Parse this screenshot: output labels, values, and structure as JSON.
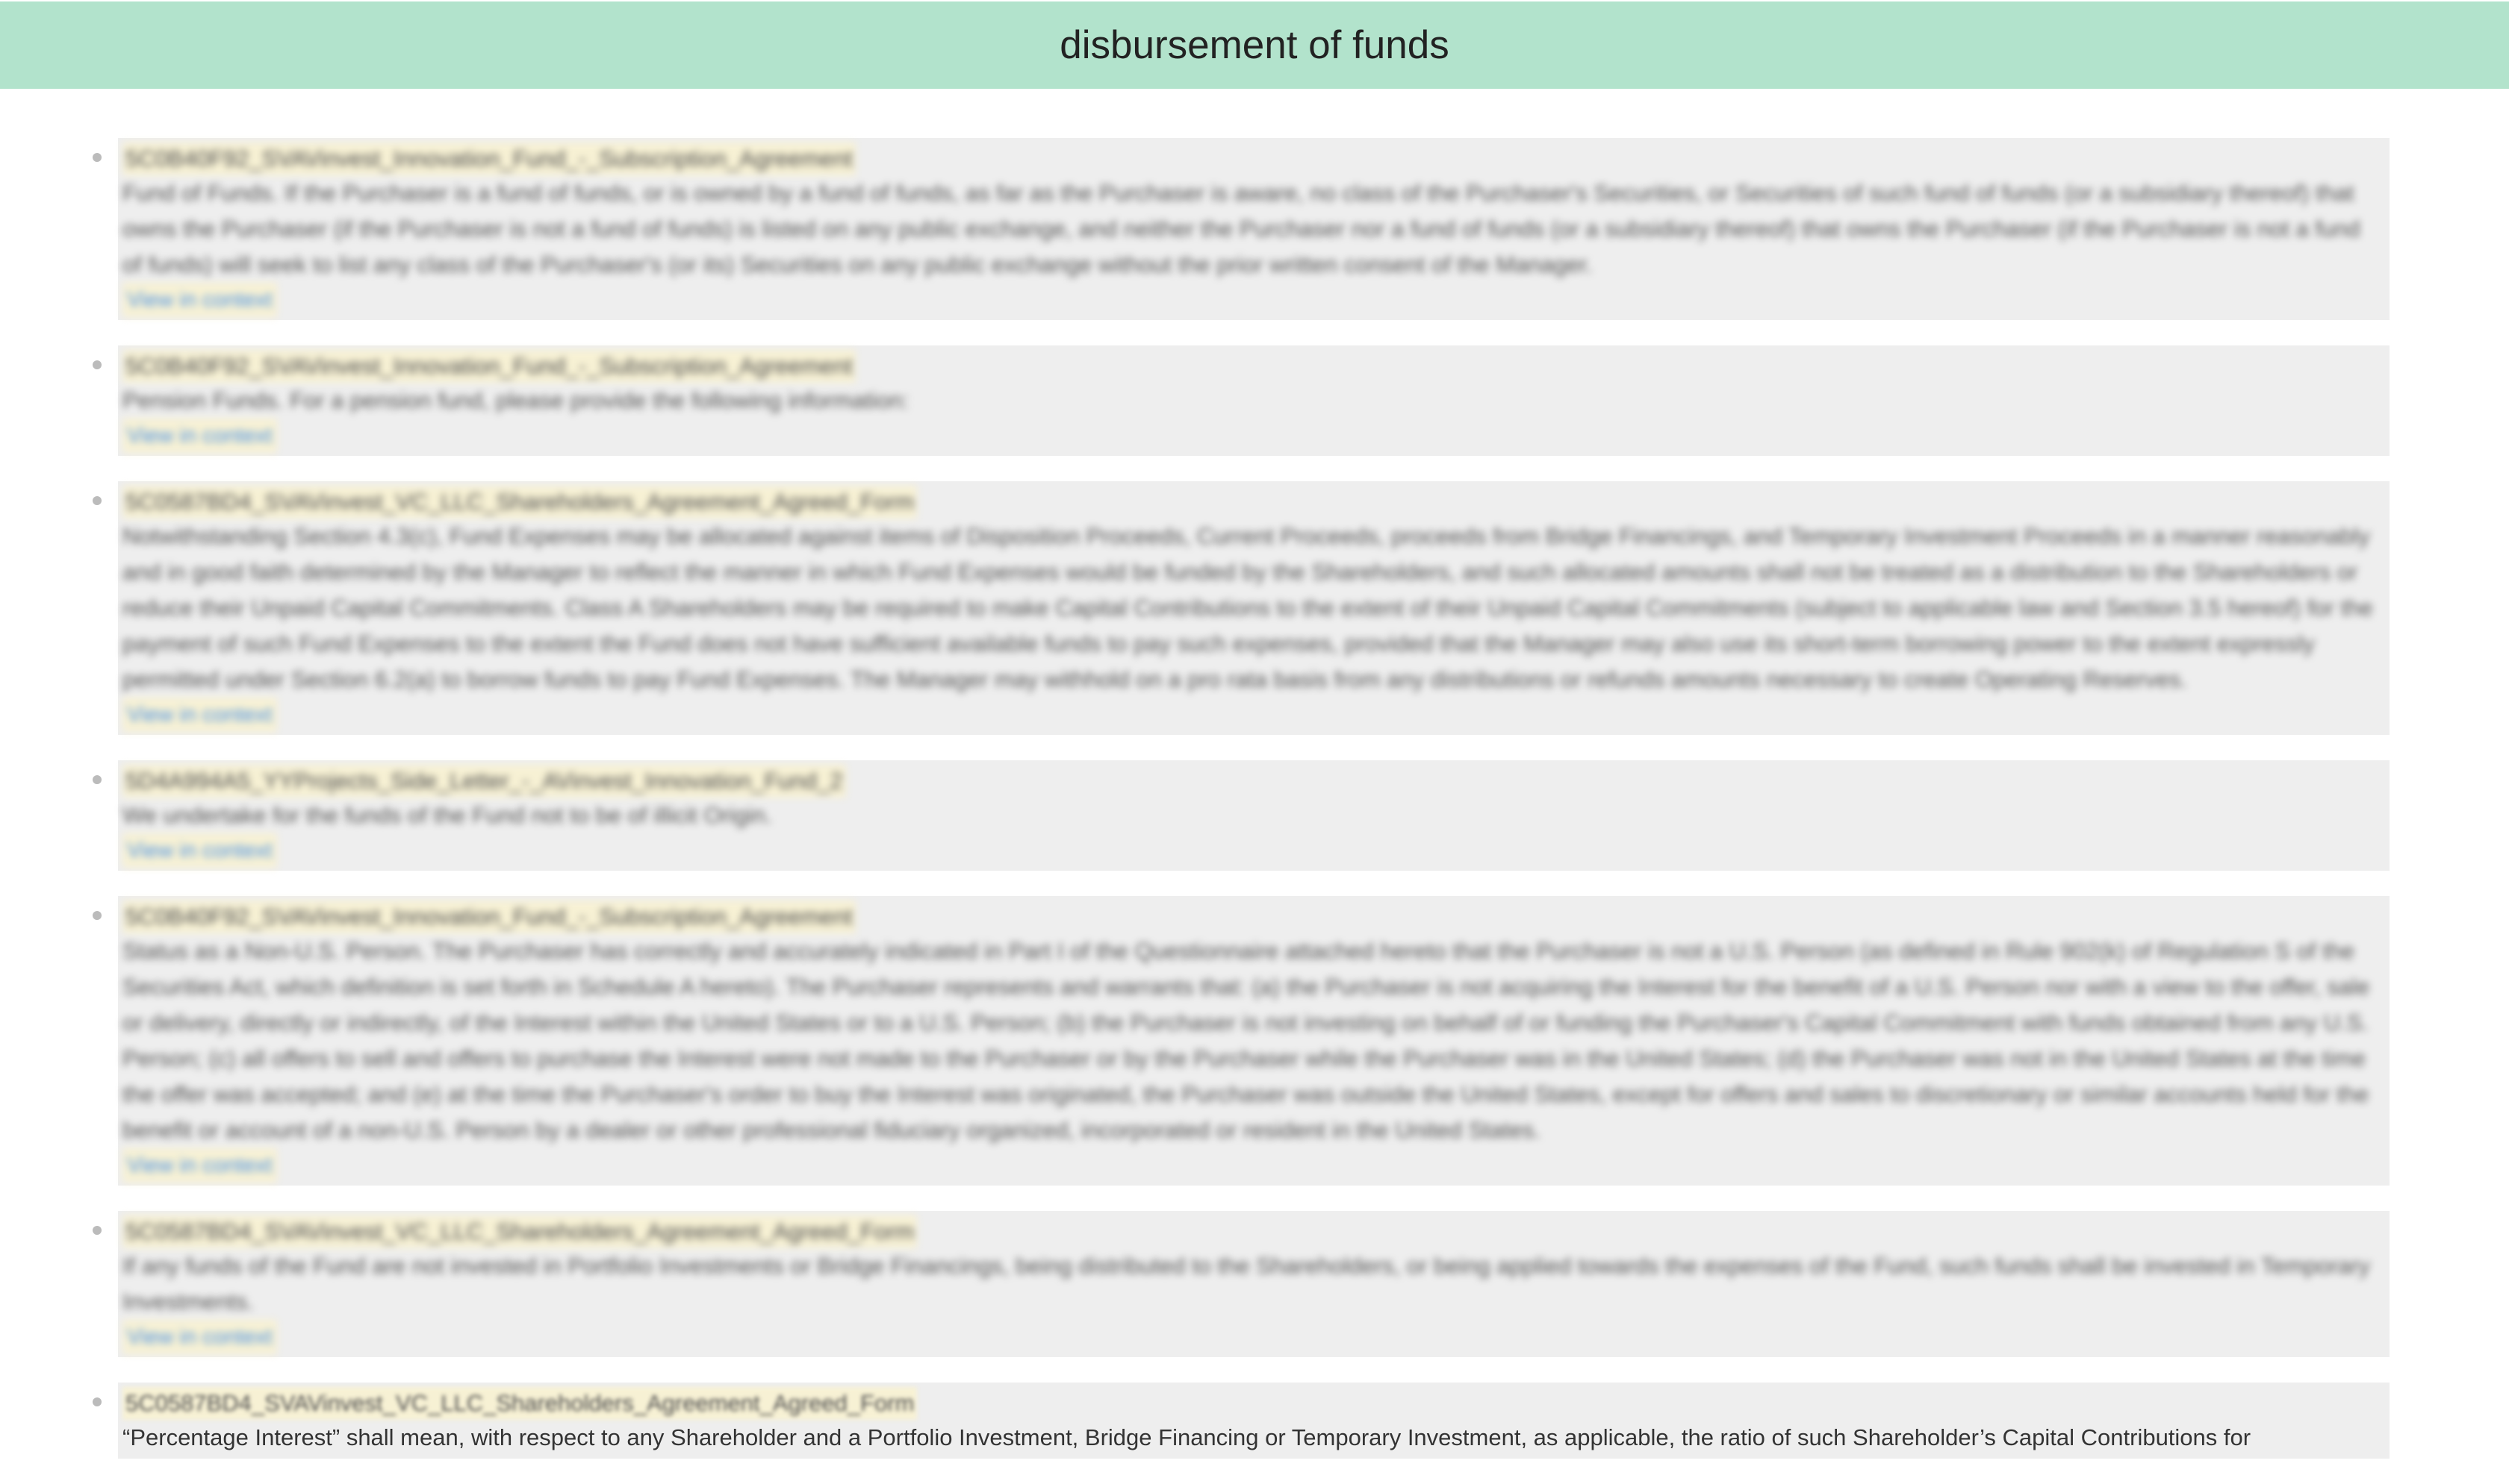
{
  "header": {
    "title": "disbursement of funds"
  },
  "results": [
    {
      "document": "5C0B40F92_SVAVinvest_Innovation_Fund_-_Subscription_Agreement",
      "snippet": "Fund of Funds. If the Purchaser is a fund of funds, or is owned by a fund of funds, as far as the Purchaser is aware, no class of the Purchaser's Securities, or Securities of such fund of funds (or a subsidiary thereof) that owns the Purchaser (if the Purchaser is not a fund of funds) is listed on any public exchange, and neither the Purchaser nor a fund of funds (or a subsidiary thereof) that owns the Purchaser (if the Purchaser is not a fund of funds) will seek to list any class of the Purchaser's (or its) Securities on any public exchange without the prior written consent of the Manager.",
      "link": "View in context"
    },
    {
      "document": "5C0B40F92_SVAVinvest_Innovation_Fund_-_Subscription_Agreement",
      "snippet": "Pension Funds. For a pension fund, please provide the following information:",
      "link": "View in context"
    },
    {
      "document": "5C0587BD4_SVAVinvest_VC_LLC_Shareholders_Agreement_Agreed_Form",
      "snippet": "Notwithstanding Section 4.3(c), Fund Expenses may be allocated against items of Disposition Proceeds, Current Proceeds, proceeds from Bridge Financings, and Temporary Investment Proceeds in a manner reasonably and in good faith determined by the Manager to reflect the manner in which Fund Expenses would be funded by the Shareholders, and such allocated amounts shall not be treated as a distribution to the Shareholders or reduce their Unpaid Capital Commitments. Class A Shareholders may be required to make Capital Contributions to the extent of their Unpaid Capital Commitments (subject to applicable law and Section 3.5 hereof) for the payment of such Fund Expenses to the extent the Fund does not have sufficient available funds to pay such expenses, provided that the Manager may also use its short-term borrowing power to the extent expressly permitted under Section 6.2(a) to borrow funds to pay Fund Expenses. The Manager may withhold on a pro rata basis from any distributions or refunds amounts necessary to create Operating Reserves.",
      "link": "View in context"
    },
    {
      "document": "5D4A994A5_YYProjects_Side_Letter_-_AVinvest_Innovation_Fund_2",
      "snippet": "We undertake for the funds of the Fund not to be of illicit Origin.",
      "link": "View in context"
    },
    {
      "document": "5C0B40F92_SVAVinvest_Innovation_Fund_-_Subscription_Agreement",
      "snippet": "Status as a Non-U.S. Person. The Purchaser has correctly and accurately indicated in Part I of the Questionnaire attached hereto that the Purchaser is not a U.S. Person (as defined in Rule 902(k) of Regulation S of the Securities Act, which definition is set forth in Schedule A hereto). The Purchaser represents and warrants that: (a) the Purchaser is not acquiring the Interest for the benefit of a U.S. Person nor with a view to the offer, sale or delivery, directly or indirectly, of the Interest within the United States or to a U.S. Person; (b) the Purchaser is not investing on behalf of or funding the Purchaser's Capital Commitment with funds obtained from any U.S. Person; (c) all offers to sell and offers to purchase the Interest were not made to the Purchaser or by the Purchaser while the Purchaser was in the United States; (d) the Purchaser was not in the United States at the time the offer was accepted; and (e) at the time the Purchaser's order to buy the Interest was originated, the Purchaser was outside the United States, except for offers and sales to discretionary or similar accounts held for the benefit or account of a non-U.S. Person by a dealer or other professional fiduciary organized, incorporated or resident in the United States.",
      "link": "View in context"
    },
    {
      "document": "5C0587BD4_SVAVinvest_VC_LLC_Shareholders_Agreement_Agreed_Form",
      "snippet": "If any funds of the Fund are not invested in Portfolio Investments or Bridge Financings, being distributed to the Shareholders, or being applied towards the expenses of the Fund, such funds shall be invested in Temporary Investments.",
      "link": "View in context"
    },
    {
      "document": "5C0587BD4_SVAVinvest_VC_LLC_Shareholders_Agreement_Agreed_Form",
      "snippet": "“Percentage Interest” shall mean, with respect to any Shareholder and a Portfolio Investment, Bridge Financing or Temporary Investment, as applicable, the ratio of such Shareholder’s Capital Contributions for",
      "link": ""
    }
  ]
}
